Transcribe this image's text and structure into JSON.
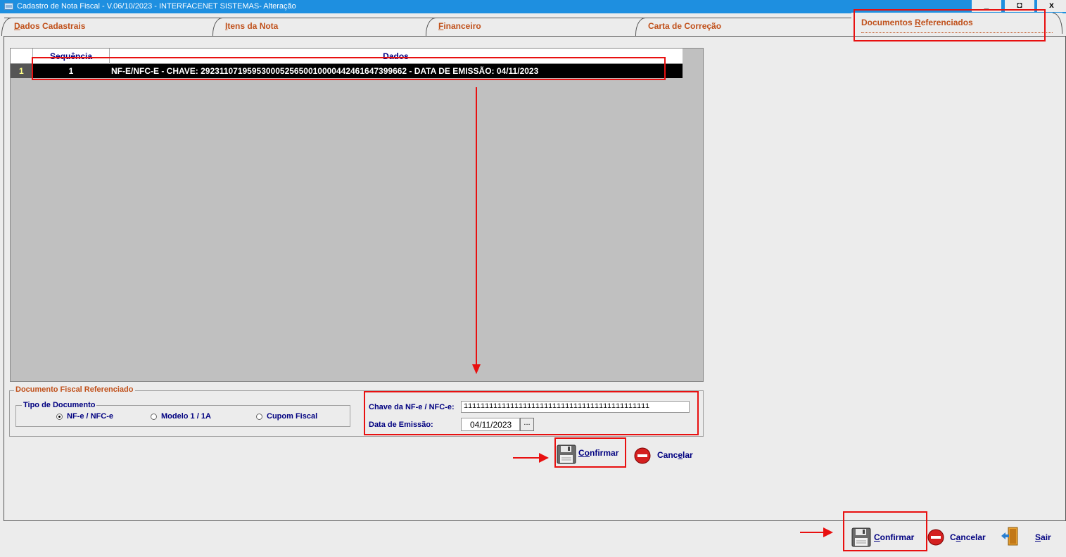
{
  "window": {
    "title": "Cadastro de Nota Fiscal - V.06/10/2023 - INTERFACENET SISTEMAS- Alteração",
    "controls": {
      "minimize": "_",
      "maximize": "◘",
      "close": "x"
    }
  },
  "tabs": [
    {
      "label_ul": "D",
      "label_rest": "ados Cadastrais"
    },
    {
      "label_ul": "I",
      "label_rest": "tens da Nota"
    },
    {
      "label_ul": "F",
      "label_rest": "inanceiro"
    },
    {
      "label_rest": "Carta de Correção"
    },
    {
      "label_pre": "Documentos ",
      "label_ul": "R",
      "label_rest": "eferenciados",
      "active": true
    }
  ],
  "grid": {
    "columns": [
      "Sequência",
      "Dados"
    ],
    "rows": [
      {
        "index": "1",
        "sequencia": "1",
        "dados": "NF-E/NFC-E - CHAVE: 29231107195953000525650010000442461647399662 - DATA DE EMISSÃO: 04/11/2023"
      }
    ]
  },
  "form": {
    "group_title": "Documento Fiscal Referenciado",
    "tipo_title": "Tipo de Documento",
    "tipos": [
      {
        "label": "NF-e / NFC-e",
        "selected": true
      },
      {
        "label": "Modelo 1 / 1A",
        "selected": false
      },
      {
        "label": "Cupom Fiscal",
        "selected": false
      }
    ],
    "chave_label": "Chave da NF-e / NFC-e:",
    "chave_value": "11111111111111111111111111111111111111111111",
    "data_label": "Data de Emissão:",
    "data_value": "04/11/2023",
    "date_btn": "..."
  },
  "inner_buttons": {
    "confirm_pre": "C",
    "confirm_ul": "o",
    "confirm_rest": "nfirmar",
    "cancel_pre": "Canc",
    "cancel_ul": "e",
    "cancel_rest": "lar"
  },
  "footer_buttons": {
    "confirm_ul": "C",
    "confirm_rest": "onfirmar",
    "cancel_pre": "C",
    "cancel_ul": "a",
    "cancel_rest": "ncelar",
    "exit_ul": "S",
    "exit_rest": "air"
  },
  "colors": {
    "titlebar": "#1e8fe0",
    "tab_text": "#c0501a",
    "label_text": "#000080",
    "highlight": "#e81010"
  }
}
